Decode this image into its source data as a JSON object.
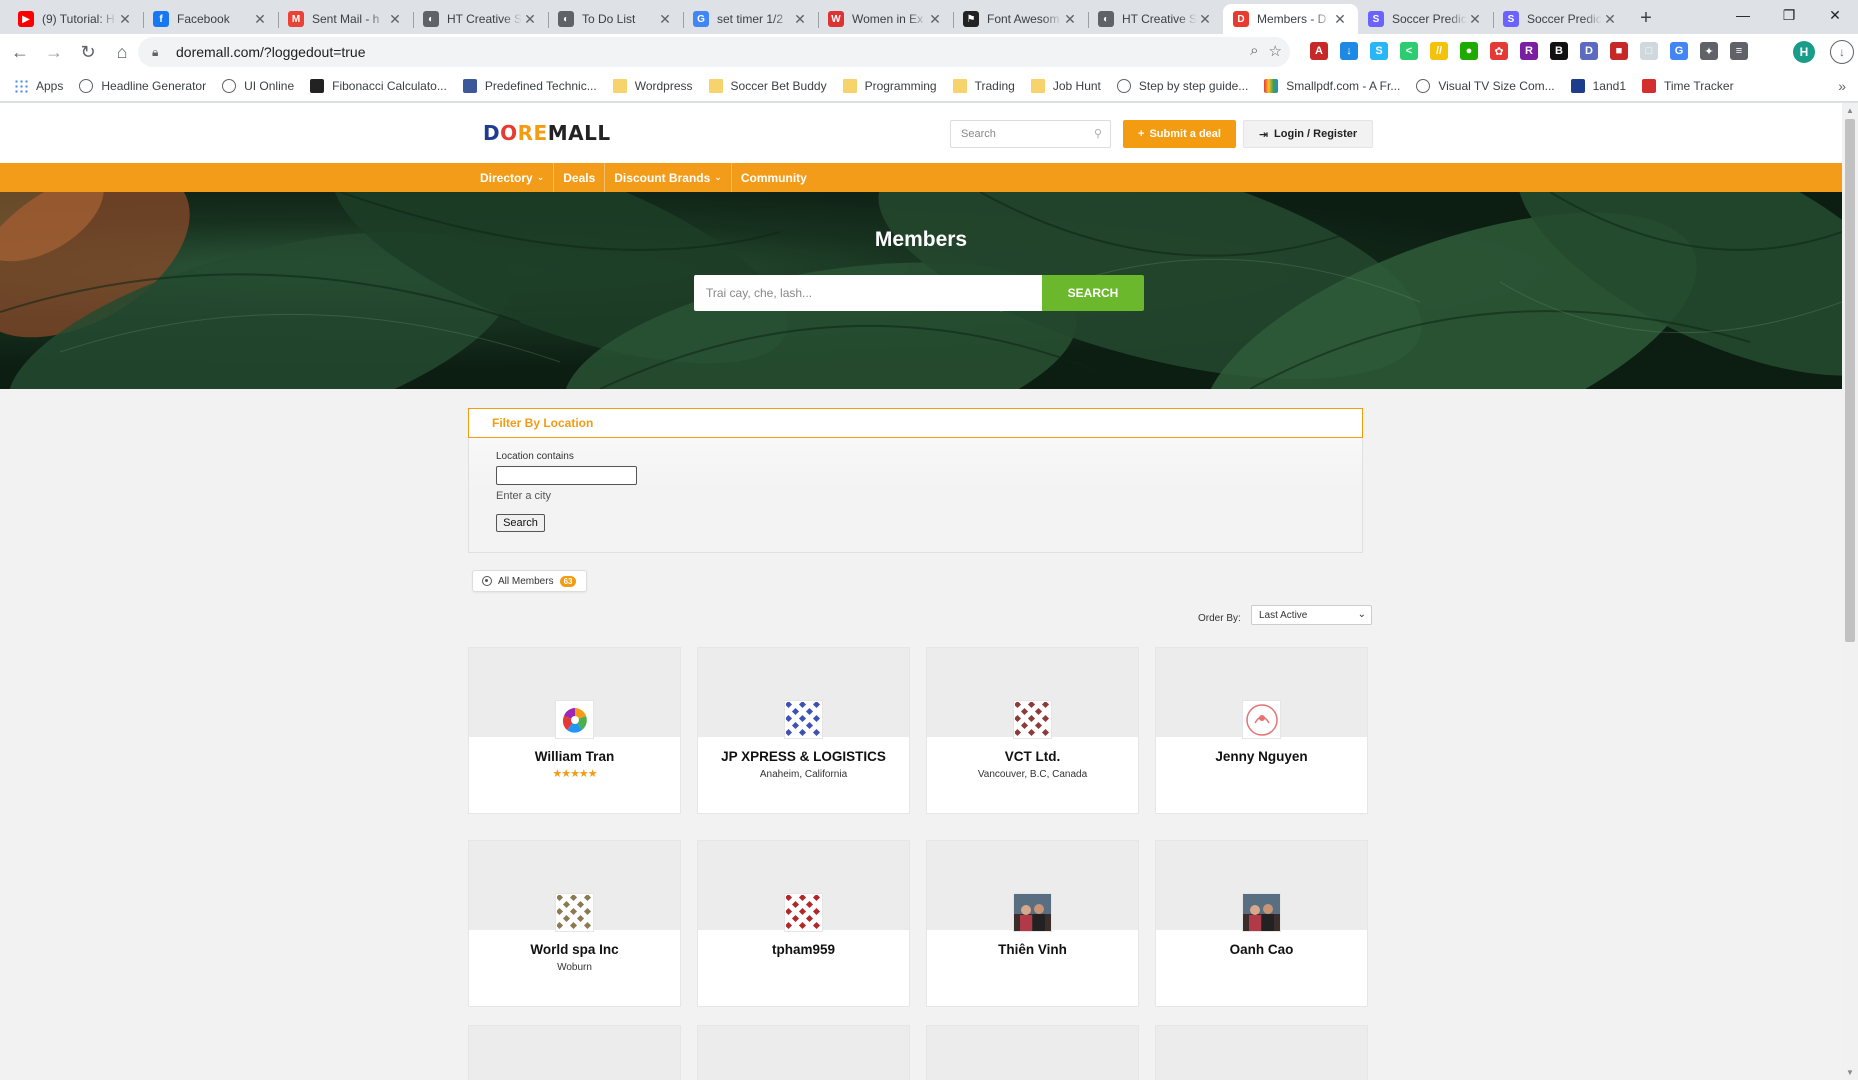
{
  "browser": {
    "tabs": [
      {
        "title": "(9) Tutorial: H",
        "favicon": "youtube-icon",
        "color": "#ff0000",
        "glyph": "▶"
      },
      {
        "title": "Facebook",
        "favicon": "facebook-icon",
        "color": "#1877f2",
        "glyph": "f"
      },
      {
        "title": "Sent Mail - h",
        "favicon": "gmail-icon",
        "color": "#ea4335",
        "glyph": "M"
      },
      {
        "title": "HT Creative S",
        "favicon": "globe-icon",
        "color": "#5f6368",
        "glyph": "◐"
      },
      {
        "title": "To Do List",
        "favicon": "globe-icon",
        "color": "#5f6368",
        "glyph": "◐"
      },
      {
        "title": "set timer 1/2",
        "favicon": "google-icon",
        "color": "#4285f4",
        "glyph": "G"
      },
      {
        "title": "Women in Ex",
        "favicon": "women-icon",
        "color": "#d33",
        "glyph": "W"
      },
      {
        "title": "Font Awesom",
        "favicon": "flag-icon",
        "color": "#222",
        "glyph": "⚑"
      },
      {
        "title": "HT Creative S",
        "favicon": "globe-icon",
        "color": "#5f6368",
        "glyph": "◐"
      },
      {
        "title": "Members - D",
        "favicon": "doremall-icon",
        "color": "#e63b2e",
        "glyph": "D",
        "active": true
      },
      {
        "title": "Soccer Predic",
        "favicon": "soccer-icon",
        "color": "#6c63ff",
        "glyph": "S"
      },
      {
        "title": "Soccer Predic",
        "favicon": "soccer-icon",
        "color": "#6c63ff",
        "glyph": "S"
      }
    ],
    "url": "doremall.com/?loggedout=true",
    "profile_initial": "H",
    "extensions": [
      {
        "name": "pdf-ext-icon",
        "color": "#c62828",
        "glyph": "A"
      },
      {
        "name": "download-ext-icon",
        "color": "#1e88e5",
        "glyph": "↓"
      },
      {
        "name": "s-ext-icon",
        "color": "#29b6f6",
        "glyph": "S"
      },
      {
        "name": "share-ext-icon",
        "color": "#2ecc71",
        "glyph": "<"
      },
      {
        "name": "bars-ext-icon",
        "color": "#f4c20d",
        "glyph": "//"
      },
      {
        "name": "green-ext-icon",
        "color": "#1faa00",
        "glyph": "●"
      },
      {
        "name": "color-ext-icon",
        "color": "#e53935",
        "glyph": "✿"
      },
      {
        "name": "r-ext-icon",
        "color": "#7b1fa2",
        "glyph": "R"
      },
      {
        "name": "b-ext-icon",
        "color": "#111111",
        "glyph": "B"
      },
      {
        "name": "d-ext-icon",
        "color": "#5c6bc0",
        "glyph": "D"
      },
      {
        "name": "red-ext-icon",
        "color": "#c62828",
        "glyph": "■"
      },
      {
        "name": "grey-ext-icon",
        "color": "#cfd8dc",
        "glyph": "□"
      },
      {
        "name": "translate-ext-icon",
        "color": "#4285f4",
        "glyph": "G"
      },
      {
        "name": "puzzle-ext-icon",
        "color": "#5f6368",
        "glyph": "✦"
      },
      {
        "name": "reading-list-icon",
        "color": "#5f6368",
        "glyph": "≡"
      }
    ]
  },
  "bookmarks": [
    {
      "label": "Apps",
      "icon": "apps-grid-icon"
    },
    {
      "label": "Headline Generator",
      "icon": "globe-icon"
    },
    {
      "label": "UI Online",
      "icon": "globe-icon"
    },
    {
      "label": "Fibonacci Calculato...",
      "icon": "inv-icon"
    },
    {
      "label": "Predefined Technic...",
      "icon": "chart-icon"
    },
    {
      "label": "Wordpress",
      "icon": "folder-icon"
    },
    {
      "label": "Soccer Bet Buddy",
      "icon": "folder-icon"
    },
    {
      "label": "Programming",
      "icon": "folder-icon"
    },
    {
      "label": "Trading",
      "icon": "folder-icon"
    },
    {
      "label": "Job Hunt",
      "icon": "folder-icon"
    },
    {
      "label": "Step by step guide...",
      "icon": "globe-icon"
    },
    {
      "label": "Smallpdf.com - A Fr...",
      "icon": "smallpdf-icon"
    },
    {
      "label": "Visual TV Size Com...",
      "icon": "globe-icon"
    },
    {
      "label": "1and1",
      "icon": "1and1-icon"
    },
    {
      "label": "Time Tracker",
      "icon": "pdf-icon"
    }
  ],
  "site": {
    "logo_parts": [
      "D",
      "O",
      "RE",
      "MALL"
    ],
    "search_placeholder": "Search",
    "submit_deal": "Submit a deal",
    "login": "Login / Register",
    "nav": [
      {
        "label": "Directory",
        "dropdown": true
      },
      {
        "label": "Deals",
        "dropdown": false
      },
      {
        "label": "Discount Brands",
        "dropdown": true
      },
      {
        "label": "Community",
        "dropdown": false
      }
    ],
    "hero_title": "Members",
    "hero_placeholder": "Trai cay, che, lash...",
    "hero_button": "SEARCH",
    "filter": {
      "title": "Filter By Location",
      "label": "Location contains",
      "hint": "Enter a city",
      "button": "Search"
    },
    "all_members": {
      "label": "All Members",
      "count": "63"
    },
    "order_by": {
      "label": "Order By:",
      "selected": "Last Active"
    },
    "members": [
      {
        "name": "William Tran",
        "location": "",
        "stars": "★★★★★",
        "avatar": "pinwheel-avatar"
      },
      {
        "name": "JP XPRESS & LOGISTICS",
        "location": "Anaheim, California",
        "stars": "",
        "avatar": "blue-pattern-avatar"
      },
      {
        "name": "VCT Ltd.",
        "location": "Vancouver, B.C, Canada",
        "stars": "",
        "avatar": "maroon-pattern-avatar"
      },
      {
        "name": "Jenny Nguyen",
        "location": "",
        "stars": "",
        "avatar": "pink-logo-avatar"
      },
      {
        "name": "World spa Inc",
        "location": "Woburn",
        "stars": "",
        "avatar": "olive-pattern-avatar"
      },
      {
        "name": "tpham959",
        "location": "",
        "stars": "",
        "avatar": "red-pattern-avatar"
      },
      {
        "name": "Thiên Vinh",
        "location": "",
        "stars": "",
        "avatar": "photo-avatar"
      },
      {
        "name": "Oanh Cao",
        "location": "",
        "stars": "",
        "avatar": "photo-avatar"
      }
    ]
  }
}
